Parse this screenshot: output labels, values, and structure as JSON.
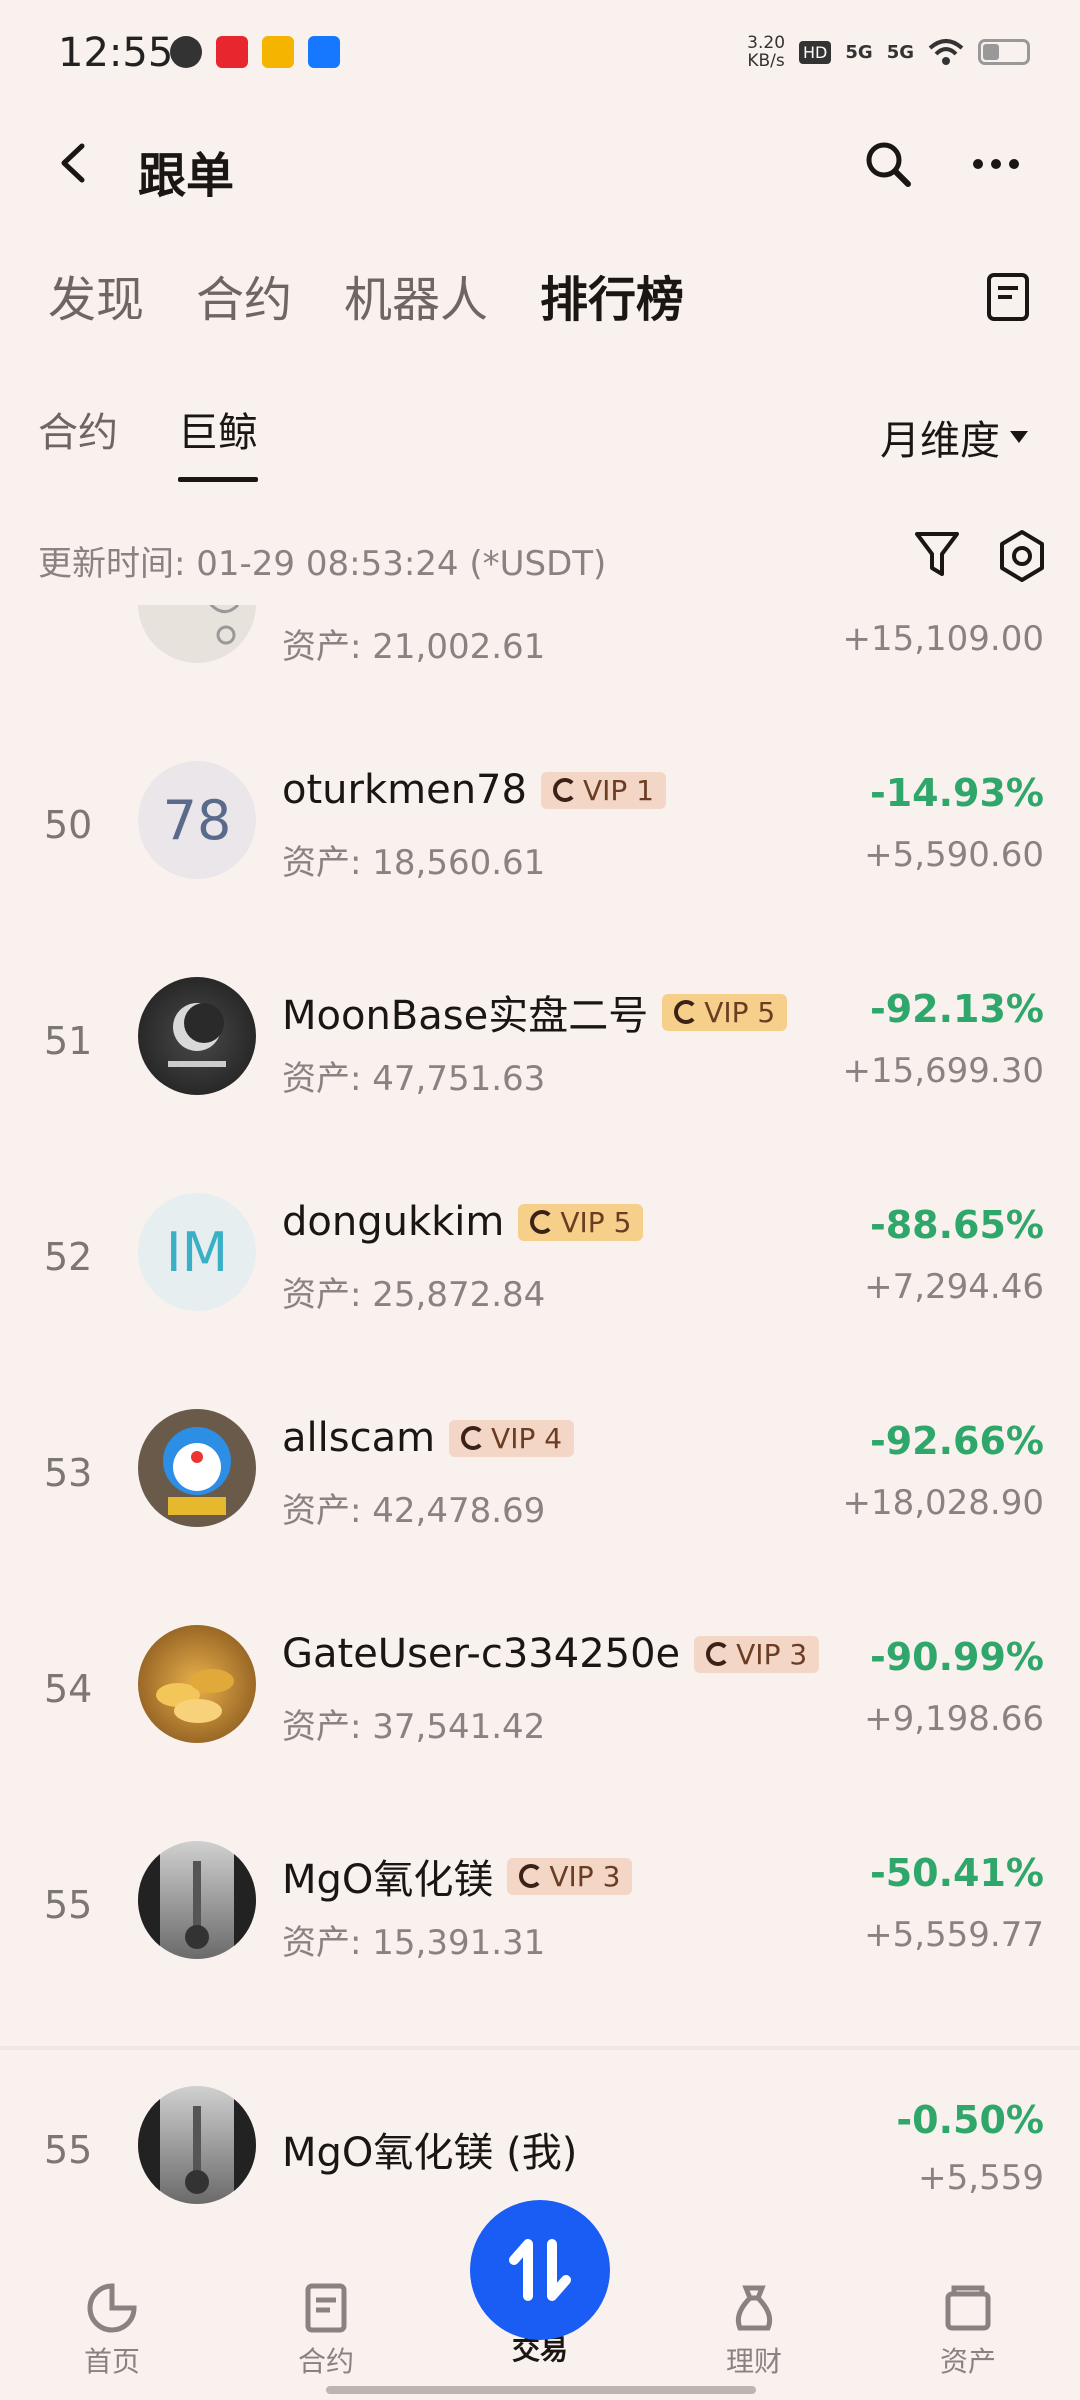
{
  "status_bar": {
    "time": "12:55",
    "speed": "3.20",
    "speed_unit": "KB/s",
    "hd": "HD",
    "net1": "5G",
    "net2": "5G"
  },
  "header": {
    "title": "跟单"
  },
  "main_tabs": [
    {
      "label": "发现"
    },
    {
      "label": "合约"
    },
    {
      "label": "机器人"
    },
    {
      "label": "排行榜"
    }
  ],
  "sub_tabs": [
    {
      "label": "合约"
    },
    {
      "label": "巨鲸"
    }
  ],
  "dimension_select": "月维度",
  "update_text": "更新时间: 01-29 08:53:24 (*USDT)",
  "rows": [
    {
      "rank": "",
      "name": "",
      "vip": "",
      "assets": "资产: 21,002.61",
      "pct": "",
      "pnl": "+15,109.00"
    },
    {
      "rank": "50",
      "avatar_text": "78",
      "name": "oturkmen78",
      "vip": "VIP 1",
      "assets": "资产: 18,560.61",
      "pct": "-14.93%",
      "pnl": "+5,590.60"
    },
    {
      "rank": "51",
      "name": "MoonBase实盘二号",
      "vip": "VIP 5",
      "assets": "资产: 47,751.63",
      "pct": "-92.13%",
      "pnl": "+15,699.30"
    },
    {
      "rank": "52",
      "avatar_text": "IM",
      "name": "dongukkim",
      "vip": "VIP 5",
      "assets": "资产: 25,872.84",
      "pct": "-88.65%",
      "pnl": "+7,294.46"
    },
    {
      "rank": "53",
      "name": "allscam",
      "vip": "VIP 4",
      "assets": "资产: 42,478.69",
      "pct": "-92.66%",
      "pnl": "+18,028.90"
    },
    {
      "rank": "54",
      "name": "GateUser-c334250e",
      "vip": "VIP 3",
      "assets": "资产: 37,541.42",
      "pct": "-90.99%",
      "pnl": "+9,198.66"
    },
    {
      "rank": "55",
      "name": "MgO氧化镁",
      "vip": "VIP 3",
      "assets": "资产: 15,391.31",
      "pct": "-50.41%",
      "pnl": "+5,559.77"
    }
  ],
  "my_row": {
    "rank": "55",
    "name": "MgO氧化镁 (我)",
    "pct": "-0.50%",
    "pnl": "+5,559"
  },
  "bottom_nav": [
    {
      "label": "首页"
    },
    {
      "label": "合约"
    },
    {
      "label": "交易"
    },
    {
      "label": "理财"
    },
    {
      "label": "资产"
    }
  ],
  "colors": {
    "background": "#f9f1ee",
    "gain": "#2fa66a",
    "accent": "#1a5df5"
  }
}
